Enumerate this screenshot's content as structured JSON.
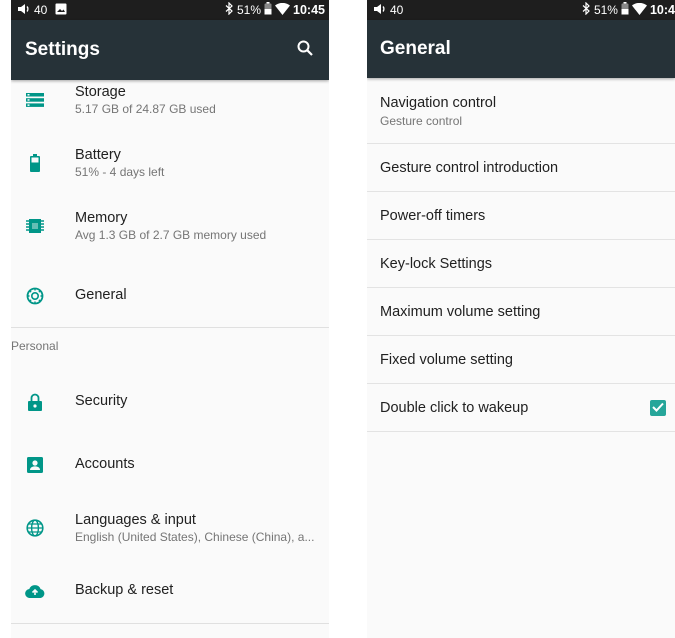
{
  "left_screen": {
    "status_bar": {
      "volume": "40",
      "battery": "51%",
      "time": "10:45"
    },
    "title": "Settings",
    "search_icon": "search-icon",
    "items": [
      {
        "title": "Storage",
        "summary": "5.17 GB of 24.87 GB used",
        "icon": "storage-icon"
      },
      {
        "title": "Battery",
        "summary": "51% - 4 days left",
        "icon": "battery-icon"
      },
      {
        "title": "Memory",
        "summary": "Avg 1.3 GB of 2.7 GB memory used",
        "icon": "memory-icon"
      },
      {
        "title": "General",
        "summary": "",
        "icon": "general-settings-icon"
      }
    ],
    "category": "Personal",
    "personal_items": [
      {
        "title": "Security",
        "summary": "",
        "icon": "lock-icon"
      },
      {
        "title": "Accounts",
        "summary": "",
        "icon": "account-icon"
      },
      {
        "title": "Languages & input",
        "summary": "English (United States), Chinese (China), a...",
        "icon": "globe-icon"
      },
      {
        "title": "Backup & reset",
        "summary": "",
        "icon": "cloud-upload-icon"
      }
    ],
    "accent_color": "#009688"
  },
  "right_screen": {
    "status_bar": {
      "volume": "40",
      "battery": "51%",
      "time": "10:4"
    },
    "title": "General",
    "items": [
      {
        "title": "Navigation control",
        "summary": "Gesture control"
      },
      {
        "title": "Gesture control introduction"
      },
      {
        "title": "Power-off timers"
      },
      {
        "title": "Key-lock Settings"
      },
      {
        "title": "Maximum volume setting"
      },
      {
        "title": "Fixed volume setting"
      },
      {
        "title": "Double click to wakeup",
        "checked": true
      }
    ],
    "checkbox_color": "#26a69a"
  }
}
